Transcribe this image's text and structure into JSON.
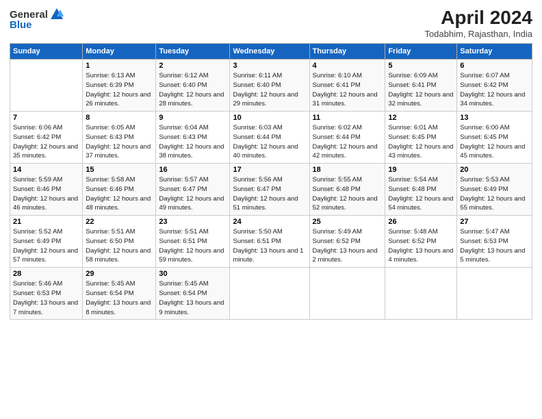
{
  "header": {
    "logo_general": "General",
    "logo_blue": "Blue",
    "month": "April 2024",
    "location": "Todabhim, Rajasthan, India"
  },
  "days_of_week": [
    "Sunday",
    "Monday",
    "Tuesday",
    "Wednesday",
    "Thursday",
    "Friday",
    "Saturday"
  ],
  "weeks": [
    [
      {
        "day": "",
        "sunrise": "",
        "sunset": "",
        "daylight": ""
      },
      {
        "day": "1",
        "sunrise": "Sunrise: 6:13 AM",
        "sunset": "Sunset: 6:39 PM",
        "daylight": "Daylight: 12 hours and 26 minutes."
      },
      {
        "day": "2",
        "sunrise": "Sunrise: 6:12 AM",
        "sunset": "Sunset: 6:40 PM",
        "daylight": "Daylight: 12 hours and 28 minutes."
      },
      {
        "day": "3",
        "sunrise": "Sunrise: 6:11 AM",
        "sunset": "Sunset: 6:40 PM",
        "daylight": "Daylight: 12 hours and 29 minutes."
      },
      {
        "day": "4",
        "sunrise": "Sunrise: 6:10 AM",
        "sunset": "Sunset: 6:41 PM",
        "daylight": "Daylight: 12 hours and 31 minutes."
      },
      {
        "day": "5",
        "sunrise": "Sunrise: 6:09 AM",
        "sunset": "Sunset: 6:41 PM",
        "daylight": "Daylight: 12 hours and 32 minutes."
      },
      {
        "day": "6",
        "sunrise": "Sunrise: 6:07 AM",
        "sunset": "Sunset: 6:42 PM",
        "daylight": "Daylight: 12 hours and 34 minutes."
      }
    ],
    [
      {
        "day": "7",
        "sunrise": "Sunrise: 6:06 AM",
        "sunset": "Sunset: 6:42 PM",
        "daylight": "Daylight: 12 hours and 35 minutes."
      },
      {
        "day": "8",
        "sunrise": "Sunrise: 6:05 AM",
        "sunset": "Sunset: 6:43 PM",
        "daylight": "Daylight: 12 hours and 37 minutes."
      },
      {
        "day": "9",
        "sunrise": "Sunrise: 6:04 AM",
        "sunset": "Sunset: 6:43 PM",
        "daylight": "Daylight: 12 hours and 38 minutes."
      },
      {
        "day": "10",
        "sunrise": "Sunrise: 6:03 AM",
        "sunset": "Sunset: 6:44 PM",
        "daylight": "Daylight: 12 hours and 40 minutes."
      },
      {
        "day": "11",
        "sunrise": "Sunrise: 6:02 AM",
        "sunset": "Sunset: 6:44 PM",
        "daylight": "Daylight: 12 hours and 42 minutes."
      },
      {
        "day": "12",
        "sunrise": "Sunrise: 6:01 AM",
        "sunset": "Sunset: 6:45 PM",
        "daylight": "Daylight: 12 hours and 43 minutes."
      },
      {
        "day": "13",
        "sunrise": "Sunrise: 6:00 AM",
        "sunset": "Sunset: 6:45 PM",
        "daylight": "Daylight: 12 hours and 45 minutes."
      }
    ],
    [
      {
        "day": "14",
        "sunrise": "Sunrise: 5:59 AM",
        "sunset": "Sunset: 6:46 PM",
        "daylight": "Daylight: 12 hours and 46 minutes."
      },
      {
        "day": "15",
        "sunrise": "Sunrise: 5:58 AM",
        "sunset": "Sunset: 6:46 PM",
        "daylight": "Daylight: 12 hours and 48 minutes."
      },
      {
        "day": "16",
        "sunrise": "Sunrise: 5:57 AM",
        "sunset": "Sunset: 6:47 PM",
        "daylight": "Daylight: 12 hours and 49 minutes."
      },
      {
        "day": "17",
        "sunrise": "Sunrise: 5:56 AM",
        "sunset": "Sunset: 6:47 PM",
        "daylight": "Daylight: 12 hours and 51 minutes."
      },
      {
        "day": "18",
        "sunrise": "Sunrise: 5:55 AM",
        "sunset": "Sunset: 6:48 PM",
        "daylight": "Daylight: 12 hours and 52 minutes."
      },
      {
        "day": "19",
        "sunrise": "Sunrise: 5:54 AM",
        "sunset": "Sunset: 6:48 PM",
        "daylight": "Daylight: 12 hours and 54 minutes."
      },
      {
        "day": "20",
        "sunrise": "Sunrise: 5:53 AM",
        "sunset": "Sunset: 6:49 PM",
        "daylight": "Daylight: 12 hours and 55 minutes."
      }
    ],
    [
      {
        "day": "21",
        "sunrise": "Sunrise: 5:52 AM",
        "sunset": "Sunset: 6:49 PM",
        "daylight": "Daylight: 12 hours and 57 minutes."
      },
      {
        "day": "22",
        "sunrise": "Sunrise: 5:51 AM",
        "sunset": "Sunset: 6:50 PM",
        "daylight": "Daylight: 12 hours and 58 minutes."
      },
      {
        "day": "23",
        "sunrise": "Sunrise: 5:51 AM",
        "sunset": "Sunset: 6:51 PM",
        "daylight": "Daylight: 12 hours and 59 minutes."
      },
      {
        "day": "24",
        "sunrise": "Sunrise: 5:50 AM",
        "sunset": "Sunset: 6:51 PM",
        "daylight": "Daylight: 13 hours and 1 minute."
      },
      {
        "day": "25",
        "sunrise": "Sunrise: 5:49 AM",
        "sunset": "Sunset: 6:52 PM",
        "daylight": "Daylight: 13 hours and 2 minutes."
      },
      {
        "day": "26",
        "sunrise": "Sunrise: 5:48 AM",
        "sunset": "Sunset: 6:52 PM",
        "daylight": "Daylight: 13 hours and 4 minutes."
      },
      {
        "day": "27",
        "sunrise": "Sunrise: 5:47 AM",
        "sunset": "Sunset: 6:53 PM",
        "daylight": "Daylight: 13 hours and 5 minutes."
      }
    ],
    [
      {
        "day": "28",
        "sunrise": "Sunrise: 5:46 AM",
        "sunset": "Sunset: 6:53 PM",
        "daylight": "Daylight: 13 hours and 7 minutes."
      },
      {
        "day": "29",
        "sunrise": "Sunrise: 5:45 AM",
        "sunset": "Sunset: 6:54 PM",
        "daylight": "Daylight: 13 hours and 8 minutes."
      },
      {
        "day": "30",
        "sunrise": "Sunrise: 5:45 AM",
        "sunset": "Sunset: 6:54 PM",
        "daylight": "Daylight: 13 hours and 9 minutes."
      },
      {
        "day": "",
        "sunrise": "",
        "sunset": "",
        "daylight": ""
      },
      {
        "day": "",
        "sunrise": "",
        "sunset": "",
        "daylight": ""
      },
      {
        "day": "",
        "sunrise": "",
        "sunset": "",
        "daylight": ""
      },
      {
        "day": "",
        "sunrise": "",
        "sunset": "",
        "daylight": ""
      }
    ]
  ]
}
